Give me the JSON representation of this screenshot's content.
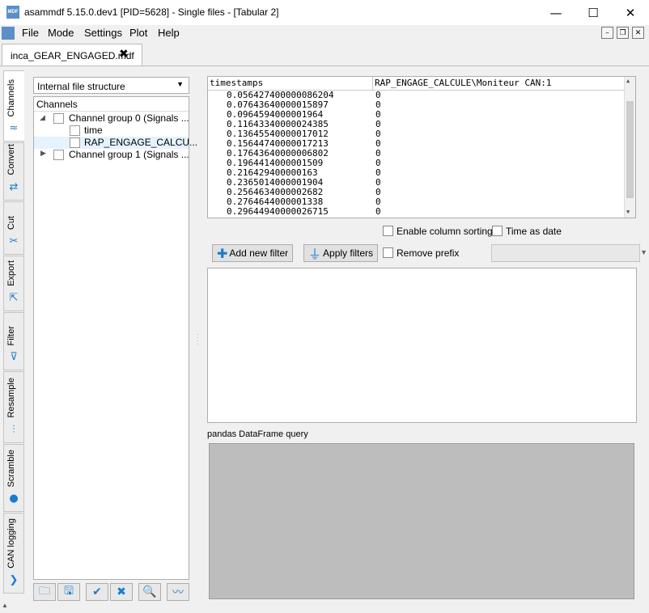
{
  "window": {
    "title": "asammdf 5.15.0.dev1 [PID=5628] - Single files - [Tabular 2]",
    "app_icon_text": "MDF",
    "minimize": "—",
    "maximize": "☐",
    "close": "✕"
  },
  "menu": {
    "items": [
      "File",
      "Mode",
      "Settings",
      "Plot",
      "Help"
    ],
    "mdi_minimize": "–",
    "mdi_restore": "❐",
    "mdi_close": "✕"
  },
  "file_tab": {
    "label": "inca_GEAR_ENGAGED.mdf",
    "close": "✖"
  },
  "side_tabs": [
    {
      "label": "Channels",
      "icon": "channels-icon",
      "glyph": "≈"
    },
    {
      "label": "Convert",
      "icon": "convert-icon",
      "glyph": "⇄"
    },
    {
      "label": "Cut",
      "icon": "scissors-icon",
      "glyph": "✂"
    },
    {
      "label": "Export",
      "icon": "export-icon",
      "glyph": "⇱"
    },
    {
      "label": "Filter",
      "icon": "filter-icon",
      "glyph": "⊽"
    },
    {
      "label": "Resample",
      "icon": "resample-icon",
      "glyph": "⫶"
    },
    {
      "label": "Scramble",
      "icon": "scramble-icon",
      "glyph": "●"
    },
    {
      "label": "CAN logging",
      "icon": "can-icon",
      "glyph": "❯"
    }
  ],
  "left_panel": {
    "structure_select": "Internal file structure",
    "tree_header": "Channels",
    "tree": [
      {
        "label": "Channel group 0 (Signals ...",
        "expanded": true
      },
      {
        "label": "time"
      },
      {
        "label": "RAP_ENGAGE_CALCU..."
      },
      {
        "label": "Channel group 1 (Signals ...",
        "expanded": false
      }
    ],
    "toolbar_icons": [
      "open-folder-icon",
      "save-icon",
      "check-all-icon",
      "uncheck-all-icon",
      "search-icon",
      "plot-icon"
    ],
    "toolbar_glyphs": [
      "🗀",
      "🖫",
      "✔",
      "✖",
      "🔍",
      "〰"
    ]
  },
  "table": {
    "columns": [
      "timestamps",
      "RAP_ENGAGE_CALCULE\\Moniteur CAN:1"
    ],
    "rows": [
      [
        "0.056427400000086204",
        "0"
      ],
      [
        "0.07643640000015897",
        "0"
      ],
      [
        "0.0964594000001964",
        "0"
      ],
      [
        "0.11643340000024385",
        "0"
      ],
      [
        "0.13645540000017012",
        "0"
      ],
      [
        "0.15644740000017213",
        "0"
      ],
      [
        "0.17643640000006802",
        "0"
      ],
      [
        "0.1964414000001509",
        "0"
      ],
      [
        "0.216429400000163",
        "0"
      ],
      [
        "0.2365014000001904",
        "0"
      ],
      [
        "0.2564634000002682",
        "0"
      ],
      [
        "0.2764644000001338",
        "0"
      ],
      [
        "0.29644940000026715",
        "0"
      ]
    ]
  },
  "options": {
    "enable_sorting": "Enable column sorting",
    "time_as_date": "Time as date",
    "remove_prefix": "Remove prefix"
  },
  "filters": {
    "add": "Add new filter",
    "apply": "Apply filters"
  },
  "query": {
    "label": "pandas DataFrame query"
  }
}
